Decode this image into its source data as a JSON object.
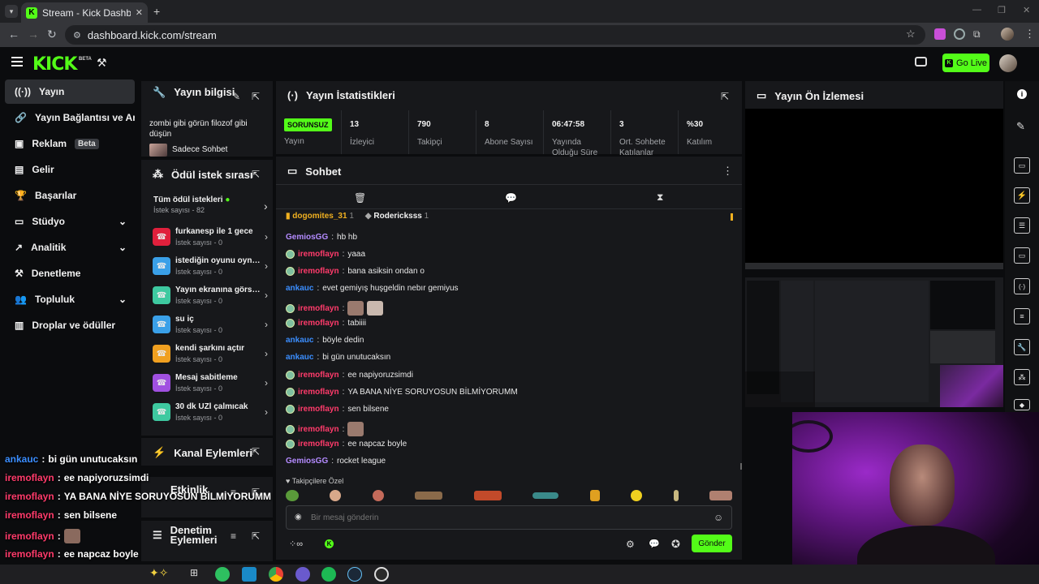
{
  "browser": {
    "tab_title": "Stream - Kick Dashboard",
    "url": "dashboard.kick.com/stream"
  },
  "header": {
    "logo": "KICK",
    "logo_badge": "BETA",
    "go_live": "Go Live"
  },
  "nav": {
    "items": [
      {
        "label": "Yayın",
        "icon": "broadcast-icon"
      },
      {
        "label": "Yayın Bağlantısı ve Anahtarı",
        "icon": "link-icon"
      },
      {
        "label": "Reklam",
        "icon": "ad-icon",
        "badge": "Beta"
      },
      {
        "label": "Gelir",
        "icon": "revenue-icon"
      },
      {
        "label": "Başarılar",
        "icon": "trophy-icon"
      },
      {
        "label": "Stüdyo",
        "icon": "studio-icon"
      },
      {
        "label": "Analitik",
        "icon": "analytics-icon"
      },
      {
        "label": "Denetleme",
        "icon": "moderation-icon"
      },
      {
        "label": "Topluluk",
        "icon": "community-icon"
      },
      {
        "label": "Droplar ve ödüller",
        "icon": "drops-icon"
      }
    ]
  },
  "stream_info": {
    "title": "Yayın bilgisi",
    "stream_title": "zombi gibi görün filozof gibi düşün",
    "category": "Sadece Sohbet"
  },
  "rewards": {
    "title": "Ödül istek sırası",
    "all_label": "Tüm ödül istekleri",
    "all_count": "İstek sayısı - 82",
    "items": [
      {
        "title": "furkanesp ile 1 gece",
        "sub": "İstek sayısı - 0",
        "color": "#e0203c"
      },
      {
        "title": "istediğin oyunu oynatma",
        "sub": "İstek sayısı - 0",
        "color": "#3aa0e8"
      },
      {
        "title": "Yayın ekranına görsel koy",
        "sub": "İstek sayısı - 0",
        "color": "#3ec9a0"
      },
      {
        "title": "su iç",
        "sub": "İstek sayısı - 0",
        "color": "#3aa0e8"
      },
      {
        "title": "kendi şarkını açtır",
        "sub": "İstek sayısı - 0",
        "color": "#f0a020"
      },
      {
        "title": "Mesaj sabitleme",
        "sub": "İstek sayısı - 0",
        "color": "#a050e0"
      },
      {
        "title": "30 dk UZİ çalmıcak",
        "sub": "İstek sayısı - 0",
        "color": "#3ec9a0"
      }
    ]
  },
  "channel_actions": {
    "title": "Kanal Eylemleri"
  },
  "activity": {
    "title": "Etkinlik"
  },
  "mod_actions": {
    "title": "Denetim Eylemleri"
  },
  "stats": {
    "title": "Yayın İstatistikleri",
    "status": "SORUNSUZ",
    "status_label": "Yayın",
    "viewers": "13",
    "viewers_label": "İzleyici",
    "followers": "790",
    "followers_label": "Takipçi",
    "subs": "8",
    "subs_label": "Abone Sayısı",
    "uptime": "06:47:58",
    "uptime_label": "Yayında Olduğu Süre",
    "avg_chatters": "3",
    "avg_chatters_label": "Ort. Sohbete Katılanlar",
    "participation": "%30",
    "participation_label": "Katılım"
  },
  "chat": {
    "title": "Sohbet",
    "pinned": [
      {
        "name": "dogomites_31",
        "count": "1"
      },
      {
        "name": "Rodericksss",
        "count": "1"
      }
    ],
    "messages": [
      {
        "user": "GemiosGG",
        "color": "#b48bff",
        "text": "hb hb",
        "badge": false
      },
      {
        "user": "iremoflayn",
        "color": "#ff3b6b",
        "text": "yaaa",
        "badge": true
      },
      {
        "user": "iremoflayn",
        "color": "#ff3b6b",
        "text": "bana asiksin ondan o",
        "badge": true
      },
      {
        "user": "ankauc",
        "color": "#3b8eff",
        "text": "evet gemiyış huşgeldin nebır gemiyus",
        "badge": false
      },
      {
        "user": "iremoflayn",
        "color": "#ff3b6b",
        "text": "",
        "badge": true,
        "emotes": 2
      },
      {
        "user": "iremoflayn",
        "color": "#ff3b6b",
        "text": "tabiiii",
        "badge": true
      },
      {
        "user": "ankauc",
        "color": "#3b8eff",
        "text": "böyle dedin",
        "badge": false
      },
      {
        "user": "ankauc",
        "color": "#3b8eff",
        "text": "bi gün unutucaksın",
        "badge": false
      },
      {
        "user": "iremoflayn",
        "color": "#ff3b6b",
        "text": "ee napiyoruzsimdi",
        "badge": true
      },
      {
        "user": "iremoflayn",
        "color": "#ff3b6b",
        "text": "YA BANA NİYE SORUYOSUN BİLMİYORUMM",
        "badge": true
      },
      {
        "user": "iremoflayn",
        "color": "#ff3b6b",
        "text": "sen bilsene",
        "badge": true
      },
      {
        "user": "iremoflayn",
        "color": "#ff3b6b",
        "text": "",
        "badge": true,
        "emotes": 1
      },
      {
        "user": "iremoflayn",
        "color": "#ff3b6b",
        "text": "ee napcaz boyle",
        "badge": true
      },
      {
        "user": "GemiosGG",
        "color": "#b48bff",
        "text": "rocket league",
        "badge": false
      }
    ],
    "followers_only": "Takipçilere Özel",
    "input_placeholder": "Bir mesaj gönderin",
    "send": "Gönder"
  },
  "preview": {
    "title": "Yayın Ön İzlemesi"
  },
  "overlay": {
    "lines": [
      {
        "user": "ankauc",
        "color": "#3b8eff",
        "text": "bi gün unutucaksın"
      },
      {
        "user": "iremoflayn",
        "color": "#ff3b6b",
        "text": "ee napiyoruzsimdi"
      },
      {
        "user": "iremoflayn",
        "color": "#ff3b6b",
        "text": "YA BANA NİYE SORUYOSUN BİLMİYORUMM"
      },
      {
        "user": "iremoflayn",
        "color": "#ff3b6b",
        "text": "sen bilsene"
      },
      {
        "user": "iremoflayn",
        "color": "#ff3b6b",
        "text": ""
      },
      {
        "user": "iremoflayn",
        "color": "#ff3b6b",
        "text": "ee napcaz boyle"
      },
      {
        "user": "GemiosGG",
        "color": "#b48bff",
        "text": "rocket league"
      }
    ]
  },
  "colors": {
    "accent": "#53fc18",
    "panel": "#17181b",
    "bg": "#0b0c0e"
  }
}
